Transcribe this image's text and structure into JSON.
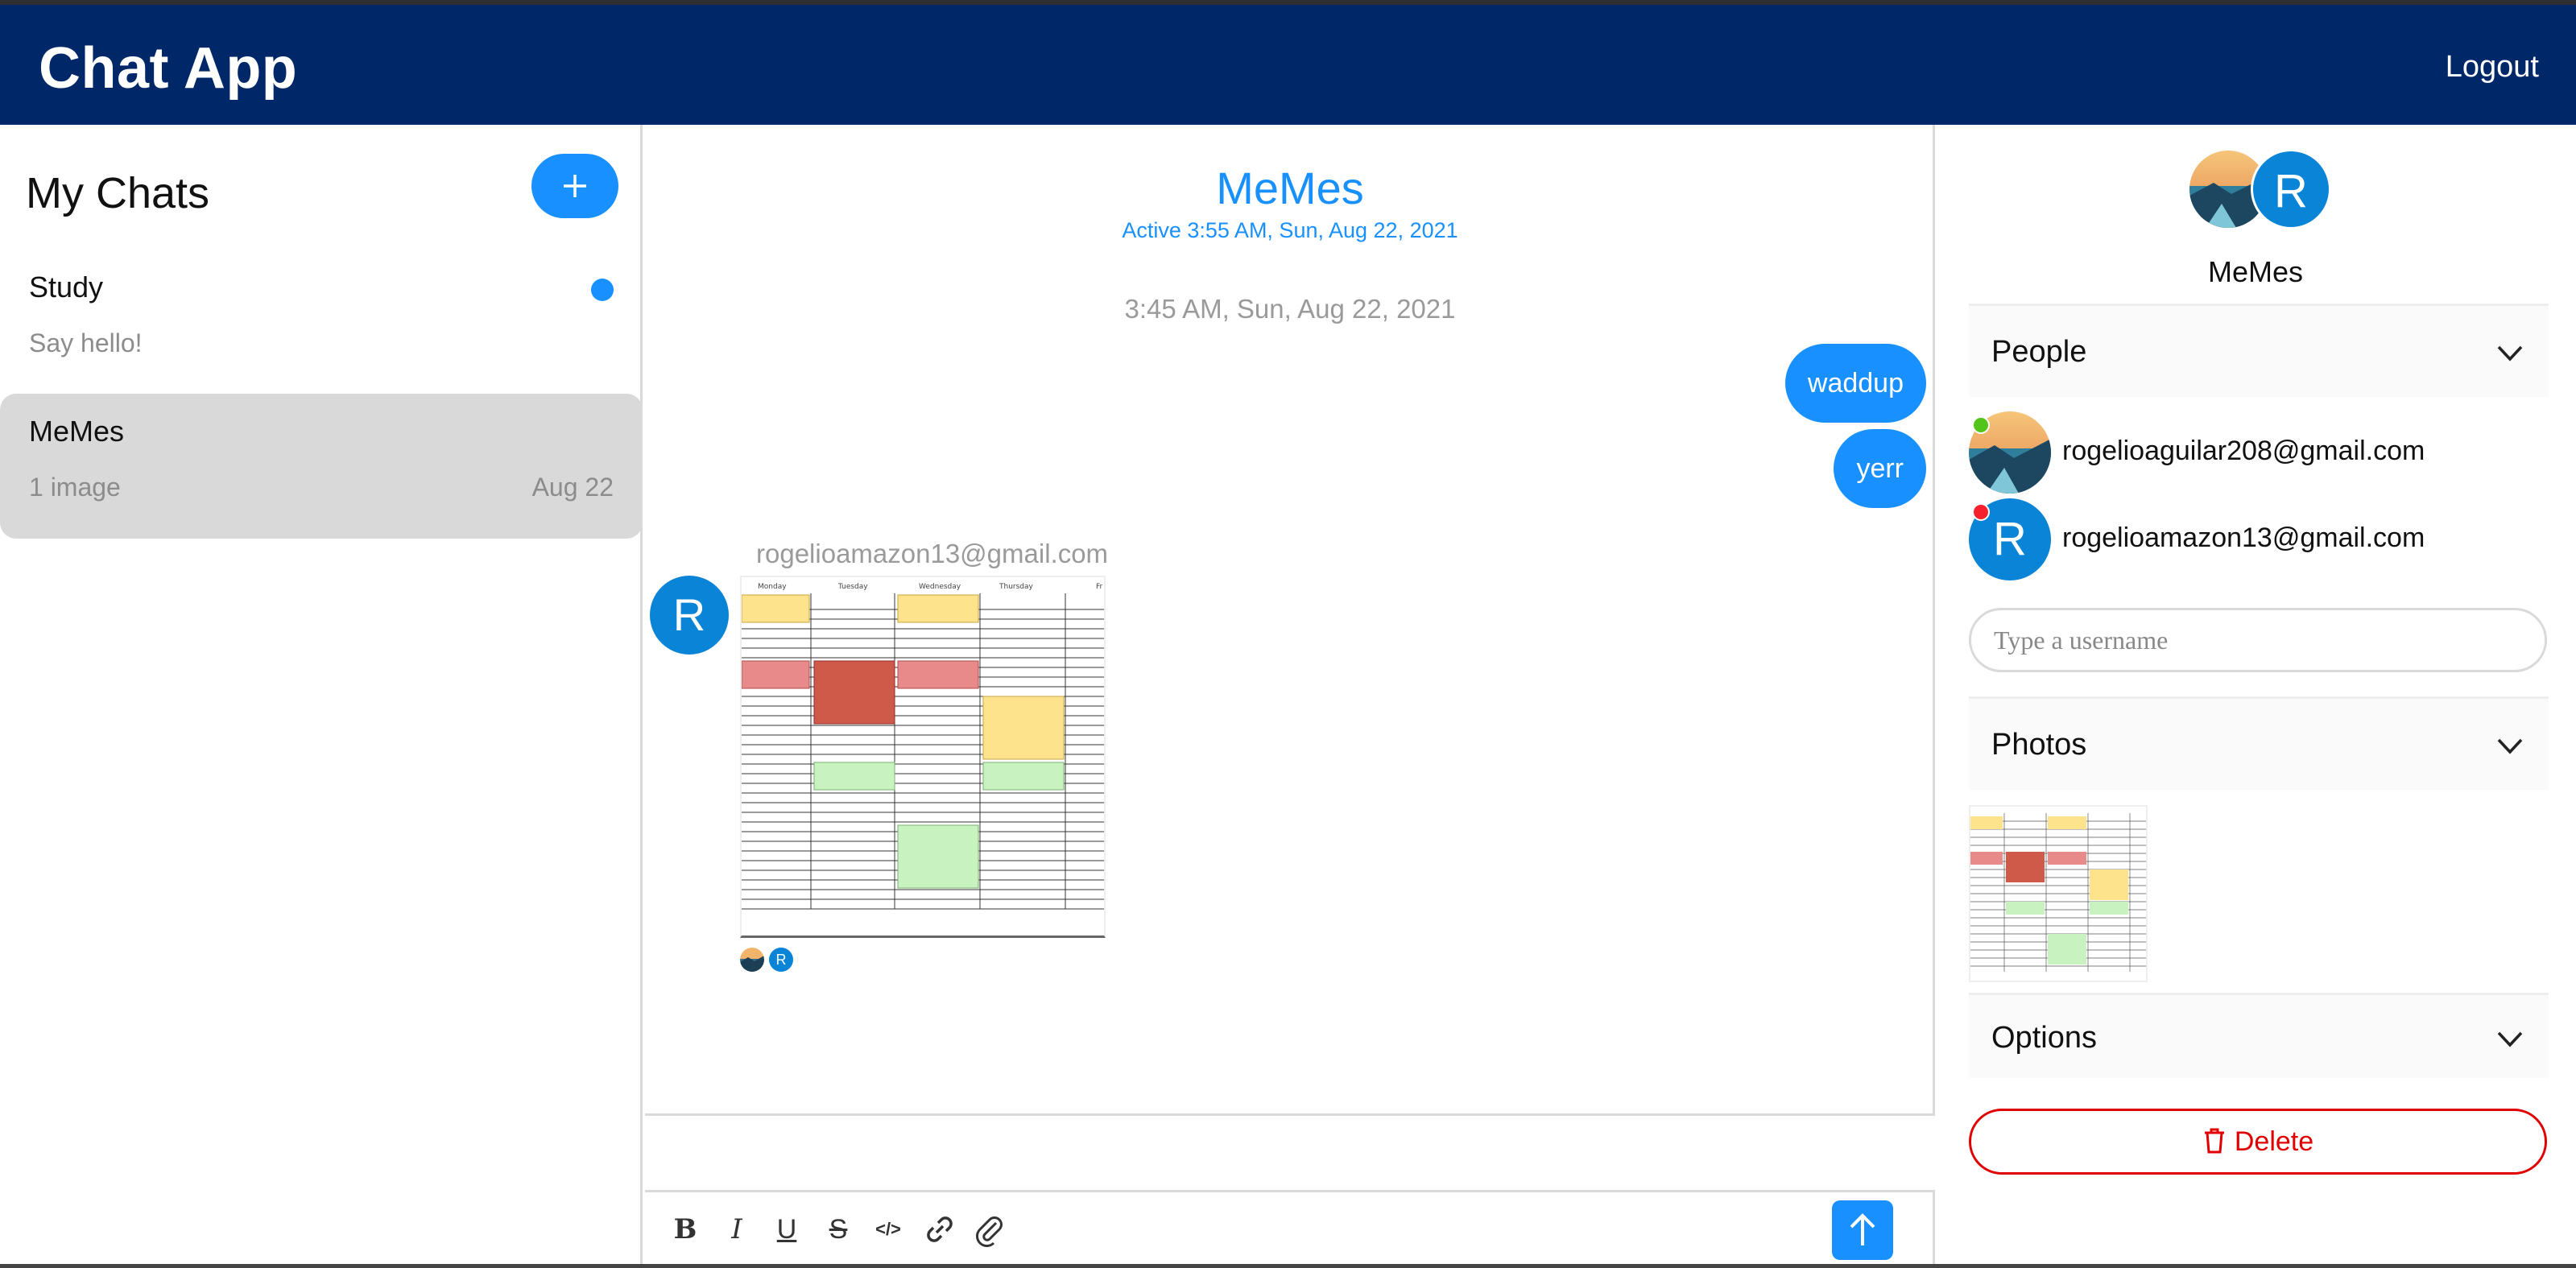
{
  "header": {
    "title": "Chat App",
    "logout_label": "Logout"
  },
  "chat_list": {
    "title": "My Chats",
    "new_chat_icon": "plus-icon",
    "chats": [
      {
        "name": "Study",
        "subtitle": "Say hello!",
        "date": "",
        "unread": true,
        "selected": false
      },
      {
        "name": "MeMes",
        "subtitle": "1 image",
        "date": "Aug 22",
        "unread": false,
        "selected": true
      }
    ]
  },
  "feed": {
    "title": "MeMes",
    "subtitle": "Active 3:55 AM, Sun, Aug 22, 2021",
    "timestamp": "3:45 AM, Sun, Aug 22, 2021",
    "my_messages": [
      "waddup",
      "yerr"
    ],
    "other_message": {
      "sender": "rogelioamazon13@gmail.com",
      "avatar_letter": "R",
      "attachment": "schedule-image"
    },
    "toolbar_icons": [
      "bold-icon",
      "italic-icon",
      "underline-icon",
      "strikethrough-icon",
      "code-icon",
      "link-icon",
      "paperclip-icon"
    ],
    "send_icon": "arrow-up-icon"
  },
  "settings": {
    "title": "MeMes",
    "avatar_letter": "R",
    "people_label": "People",
    "people": [
      {
        "email": "rogelioaguilar208@gmail.com",
        "online": true,
        "avatar": "landscape"
      },
      {
        "email": "rogelioamazon13@gmail.com",
        "online": false,
        "avatar_letter": "R"
      }
    ],
    "username_placeholder": "Type a username",
    "photos_label": "Photos",
    "options_label": "Options",
    "delete_label": "Delete"
  },
  "colors": {
    "header_bg": "#002868",
    "accent": "#1890ff",
    "avatar_blue": "#0a84d6",
    "danger": "#e00000",
    "online": "#52c41a",
    "offline": "#f5222d"
  }
}
